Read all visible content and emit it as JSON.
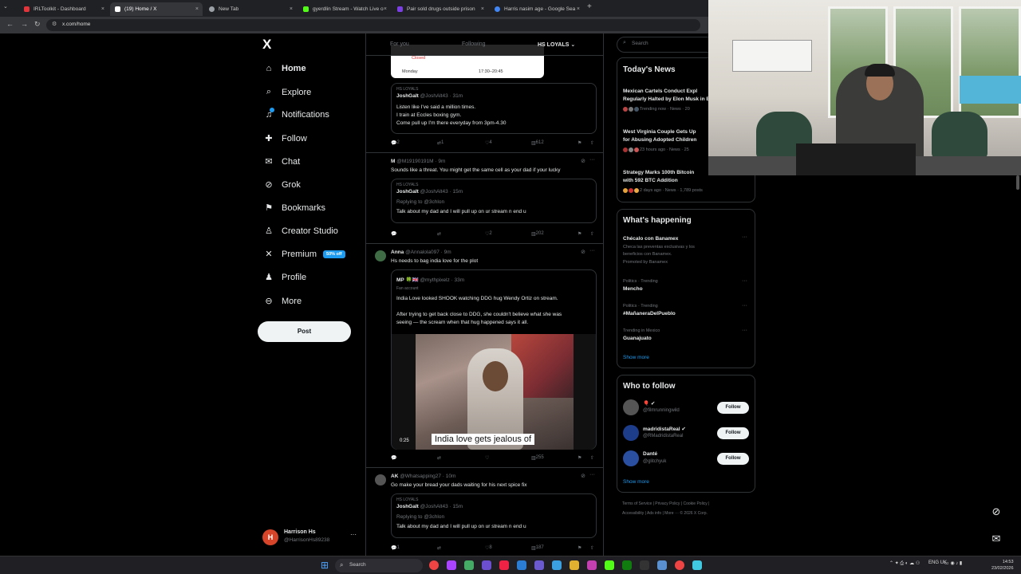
{
  "browser": {
    "tabs": [
      {
        "label": "IRLToolkit - Dashboard",
        "color": "#e2343b"
      },
      {
        "label": "(19) Home / X",
        "color": "#ffffff"
      },
      {
        "label": "New Tab",
        "color": "#9aa0a6"
      },
      {
        "label": "gyerdlin Stream - Watch Live o",
        "color": "#53fc18"
      },
      {
        "label": "Pair sold drugs outside prison ",
        "color": "#7b3fe4"
      },
      {
        "label": "Harris nasim age - Google Sea",
        "color": "#4285f4"
      }
    ],
    "close_glyph": "×",
    "new_tab_glyph": "+",
    "url": "x.com/home"
  },
  "sidebar": {
    "logo": "X",
    "items": [
      {
        "label": "Home",
        "icon": "home-icon",
        "glyph": "⌂"
      },
      {
        "label": "Explore",
        "icon": "search-icon",
        "glyph": "⌕"
      },
      {
        "label": "Notifications",
        "icon": "bell-icon",
        "glyph": "♫"
      },
      {
        "label": "Follow",
        "icon": "person-add-icon",
        "glyph": "✚"
      },
      {
        "label": "Chat",
        "icon": "mail-icon",
        "glyph": "✉"
      },
      {
        "label": "Grok",
        "icon": "grok-icon",
        "glyph": "⊘"
      },
      {
        "label": "Bookmarks",
        "icon": "bookmark-icon",
        "glyph": "⚑"
      },
      {
        "label": "Creator Studio",
        "icon": "creator-icon",
        "glyph": "♙"
      },
      {
        "label": "Premium",
        "icon": "x-premium-icon",
        "glyph": "✕"
      },
      {
        "label": "Profile",
        "icon": "profile-icon",
        "glyph": "♟"
      },
      {
        "label": "More",
        "icon": "more-icon",
        "glyph": "⊖"
      }
    ],
    "premium_badge": "50% off",
    "post_label": "Post",
    "account": {
      "initial": "H",
      "name": "Harrison Hs",
      "handle": "@HarrisonHs89238",
      "dots": "···"
    }
  },
  "feed": {
    "tabs": [
      "For you",
      "Following",
      "HS LOYALS ⌄"
    ],
    "schedule": {
      "status": "Closed",
      "day": "Monday",
      "hours": "17:30–20:45"
    },
    "tweet1": {
      "community": "HS LOYALS",
      "name": "JoshGalt",
      "meta": "@JoshAlt43 · 31m",
      "lines": [
        "Listen like I've said a million times.",
        "I train at Eccles boxing gym.",
        "Come pull up I'm there everyday from 3pm-4.30"
      ],
      "replies": "2",
      "reposts": "1",
      "likes": "4",
      "views": "612"
    },
    "tweet2": {
      "name": "M",
      "meta": "@M19190191M · 9m",
      "text": "Sounds like a threat. You might get the same cell as your dad if your lucky",
      "quote": {
        "community": "HS LOYALS",
        "name": "JoshGalt",
        "meta": "@JoshAlt43 · 15m",
        "reply": "Replying to @3chlon",
        "text": "Talk about my dad and I will pull up on ur stream n end u"
      },
      "replies": "",
      "reposts": "",
      "likes": "2",
      "views": "202"
    },
    "tweet3": {
      "name": "Anna",
      "meta": "@Annalola097 · 9m",
      "text": "Hs needs to bag india love for the plot",
      "quote": {
        "name": "MP 🍀🇬🇧",
        "meta": "@mythpixelz · 33m",
        "label": "Fan account",
        "line1": "India Love looked SHOOK watching DDG hug Wendy Ortiz on stream.",
        "line2": "After trying to get back close to DDG, she couldn't believe what she was",
        "line3": "seeing — the scream when that hug happened says it all."
      },
      "video_time": "0:25",
      "caption": "India love gets jealous of",
      "replies": "",
      "reposts": "",
      "likes": "",
      "views": "255"
    },
    "tweet4": {
      "name": "AK",
      "meta": "@Whatsapping27 · 10m",
      "text": "Go make your bread your dads waiting for his next spice fix",
      "quote": {
        "community": "HS LOYALS",
        "name": "JoshGalt",
        "meta": "@JoshAlt43 · 15m",
        "reply": "Replying to @3chlon",
        "text": "Talk about my dad and I will pull up on ur stream n end u"
      },
      "replies": "1",
      "reposts": "",
      "likes": "8",
      "views": "187"
    }
  },
  "right": {
    "search_placeholder": "Search",
    "news_title": "Today's News",
    "news": [
      {
        "title1": "Mexican Cartels Conduct Expl",
        "title2": "Regularly Halted by Elon Musk in Bo",
        "meta": "Trending now · News · 20"
      },
      {
        "title1": "West Virginia Couple Gets Up",
        "title2": "for Abusing Adopted Children",
        "meta": "23 hours ago · News · 25"
      },
      {
        "title1": "Strategy Marks 100th Bitcoin",
        "title2": "with 592 BTC Addition",
        "meta": "2 days ago · News · 1,789 posts"
      }
    ],
    "happening_title": "What's happening",
    "promo": {
      "title": "Chécalo con Banamex",
      "line1": "Checa las preventas exclusivas y los",
      "line2": "beneficios con Banamex.",
      "line3": "Promoted by Banamex"
    },
    "trends": [
      {
        "context": "Politics · Trending",
        "name": "Mencho"
      },
      {
        "context": "Politics · Trending",
        "name": "#MañaneraDelPueblo"
      },
      {
        "context": "Trending in Mexico",
        "name": "Guanajuato"
      }
    ],
    "show_more": "Show more",
    "wtf_title": "Who to follow",
    "wtf": [
      {
        "name": "🎈 ✔",
        "handle": "@filmrunningwild",
        "color": "#555555"
      },
      {
        "name": "madridistaReal ✔",
        "handle": "@RMadridistaReal",
        "color": "#1d3c8a"
      },
      {
        "name": "Danté",
        "handle": "@glitchyuk",
        "color": "#2a4fa0"
      }
    ],
    "follow_label": "Follow",
    "footer1": "Terms of Service  |  Privacy Policy  |  Cookie Policy  |",
    "footer2": "Accessibility  |  Ads info  |  More ···  © 2026 X Corp."
  },
  "taskbar": {
    "search": "Search",
    "tray": "ENG UK",
    "time": "14:53",
    "date": "23/02/2026"
  }
}
